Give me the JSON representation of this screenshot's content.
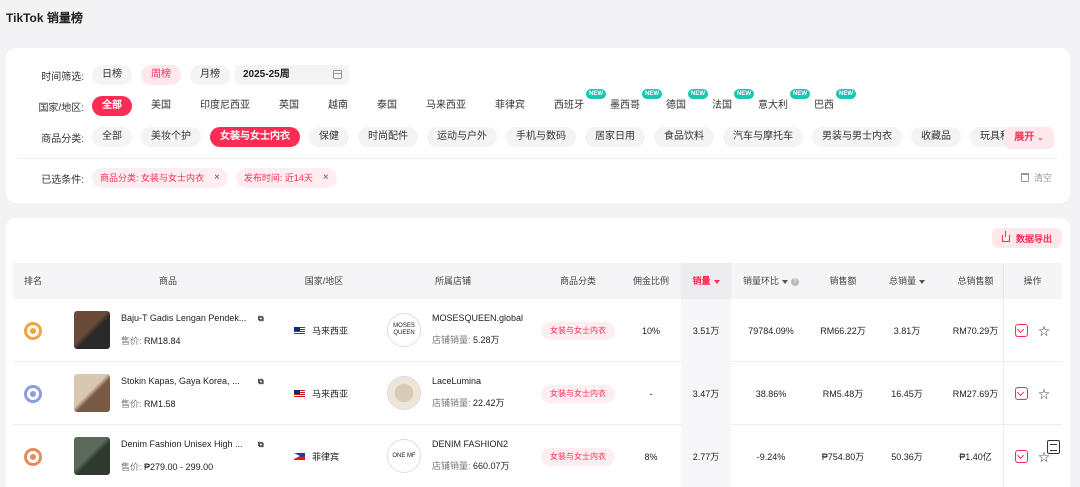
{
  "page": {
    "title": "TikTok 销量榜"
  },
  "filters": {
    "time": {
      "label": "时间筛选:",
      "options": [
        "日榜",
        "周榜",
        "月榜"
      ],
      "selected": "周榜",
      "week_value": "2025-25周"
    },
    "region": {
      "label": "国家/地区:",
      "options": [
        {
          "label": "全部",
          "new": false,
          "active": true
        },
        {
          "label": "美国",
          "new": false
        },
        {
          "label": "印度尼西亚",
          "new": false
        },
        {
          "label": "英国",
          "new": false
        },
        {
          "label": "越南",
          "new": false
        },
        {
          "label": "泰国",
          "new": false
        },
        {
          "label": "马来西亚",
          "new": false
        },
        {
          "label": "菲律宾",
          "new": false
        },
        {
          "label": "西班牙",
          "new": true
        },
        {
          "label": "墨西哥",
          "new": true
        },
        {
          "label": "德国",
          "new": true
        },
        {
          "label": "法国",
          "new": true
        },
        {
          "label": "意大利",
          "new": true
        },
        {
          "label": "巴西",
          "new": true
        }
      ],
      "new_badge": "NEW"
    },
    "category": {
      "label": "商品分类:",
      "options": [
        "全部",
        "美妆个护",
        "女装与女士内衣",
        "保健",
        "时尚配件",
        "运动与户外",
        "手机与数码",
        "居家日用",
        "食品饮料",
        "汽车与摩托车",
        "男装与男士内衣",
        "收藏品",
        "玩具和爱好"
      ],
      "selected": "女装与女士内衣",
      "expand_label": "展开"
    },
    "applied": {
      "label": "已选条件:",
      "chips": [
        "商品分类: 女装与女士内衣",
        "发布时间: 近14天"
      ],
      "clear_label": "清空"
    }
  },
  "table": {
    "export_label": "数据导出",
    "headers": {
      "rank": "排名",
      "product": "商品",
      "region": "国家/地区",
      "shop": "所属店铺",
      "category": "商品分类",
      "commission": "佣金比例",
      "sales": "销量",
      "sales_change": "销量环比",
      "revenue": "销售额",
      "total_sales": "总销量",
      "total_revenue": "总销售额",
      "actions": "操作"
    },
    "price_label": "售价:",
    "shop_sales_label": "店铺销量:",
    "rows": [
      {
        "rank_color": "#f0a640",
        "thumb_colors": [
          "#6b4a3a",
          "#2a2a2a"
        ],
        "name": "Baju-T Gadis Lengan Pendek...",
        "price": "RM18.84",
        "flag": "my",
        "region": "马来西亚",
        "shop_logo": "MOSES QUEEN",
        "shop_name": "MOSESQUEEN.global",
        "shop_sales": "5.28万",
        "category": "女装与女士内衣",
        "commission": "10%",
        "sales": "3.51万",
        "sales_change": "79784.09%",
        "revenue": "RM66.22万",
        "total_sales": "3.81万",
        "total_revenue": "RM70.29万"
      },
      {
        "rank_color": "#8a9ed8",
        "thumb_colors": [
          "#d9c7b4",
          "#7a5a45"
        ],
        "name": "Stokin Kapas, Gaya Korea, ...",
        "price": "RM1.58",
        "flag": "my",
        "region": "马来西亚",
        "shop_logo": "",
        "shop_name": "LaceLumina",
        "shop_sales": "22.42万",
        "category": "女装与女士内衣",
        "commission": "-",
        "sales": "3.47万",
        "sales_change": "38.86%",
        "revenue": "RM5.48万",
        "total_sales": "16.45万",
        "total_revenue": "RM27.69万"
      },
      {
        "rank_color": "#e88a5a",
        "thumb_colors": [
          "#5a6a5a",
          "#2d3a2d"
        ],
        "name": "Denim Fashion Unisex High ...",
        "price": "₱279.00 - 299.00",
        "flag": "ph",
        "region": "菲律宾",
        "shop_logo": "ONE MF",
        "shop_name": "DENIM FASHION2",
        "shop_sales": "660.07万",
        "category": "女装与女士内衣",
        "commission": "8%",
        "sales": "2.77万",
        "sales_change": "-9.24%",
        "revenue": "₱754.80万",
        "total_sales": "50.36万",
        "total_revenue": "₱1.40亿"
      }
    ]
  },
  "icons": {
    "copy": "copy-icon",
    "favorite": "star-icon",
    "detail": "check-box-icon",
    "calendar": "calendar-icon",
    "trash": "trash-icon",
    "export": "export-icon",
    "floating_doc": "document-icon"
  },
  "colors": {
    "accent": "#fe2c55",
    "new_badge": "#19c5b3"
  }
}
